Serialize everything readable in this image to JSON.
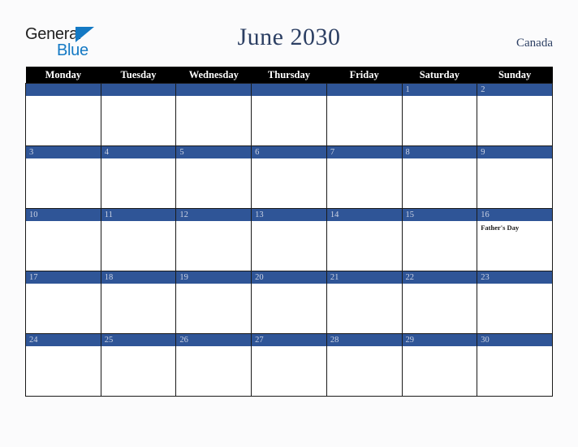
{
  "brand": {
    "name_line1": "General",
    "name_line2": "Blue",
    "triangle_icon": "triangle-icon",
    "color_dark": "#1f1f1f",
    "color_blue": "#1479c4"
  },
  "header": {
    "title": "June 2030",
    "region": "Canada",
    "title_color": "#2c3f63"
  },
  "calendar": {
    "accent_color": "#2f5597",
    "header_bg": "#000000",
    "day_number_color": "#ccd3e4",
    "weekday_headers": [
      "Monday",
      "Tuesday",
      "Wednesday",
      "Thursday",
      "Friday",
      "Saturday",
      "Sunday"
    ],
    "weeks": [
      [
        {
          "day": "",
          "events": []
        },
        {
          "day": "",
          "events": []
        },
        {
          "day": "",
          "events": []
        },
        {
          "day": "",
          "events": []
        },
        {
          "day": "",
          "events": []
        },
        {
          "day": "1",
          "events": []
        },
        {
          "day": "2",
          "events": []
        }
      ],
      [
        {
          "day": "3",
          "events": []
        },
        {
          "day": "4",
          "events": []
        },
        {
          "day": "5",
          "events": []
        },
        {
          "day": "6",
          "events": []
        },
        {
          "day": "7",
          "events": []
        },
        {
          "day": "8",
          "events": []
        },
        {
          "day": "9",
          "events": []
        }
      ],
      [
        {
          "day": "10",
          "events": []
        },
        {
          "day": "11",
          "events": []
        },
        {
          "day": "12",
          "events": []
        },
        {
          "day": "13",
          "events": []
        },
        {
          "day": "14",
          "events": []
        },
        {
          "day": "15",
          "events": []
        },
        {
          "day": "16",
          "events": [
            "Father's Day"
          ]
        }
      ],
      [
        {
          "day": "17",
          "events": []
        },
        {
          "day": "18",
          "events": []
        },
        {
          "day": "19",
          "events": []
        },
        {
          "day": "20",
          "events": []
        },
        {
          "day": "21",
          "events": []
        },
        {
          "day": "22",
          "events": []
        },
        {
          "day": "23",
          "events": []
        }
      ],
      [
        {
          "day": "24",
          "events": []
        },
        {
          "day": "25",
          "events": []
        },
        {
          "day": "26",
          "events": []
        },
        {
          "day": "27",
          "events": []
        },
        {
          "day": "28",
          "events": []
        },
        {
          "day": "29",
          "events": []
        },
        {
          "day": "30",
          "events": []
        }
      ]
    ]
  }
}
